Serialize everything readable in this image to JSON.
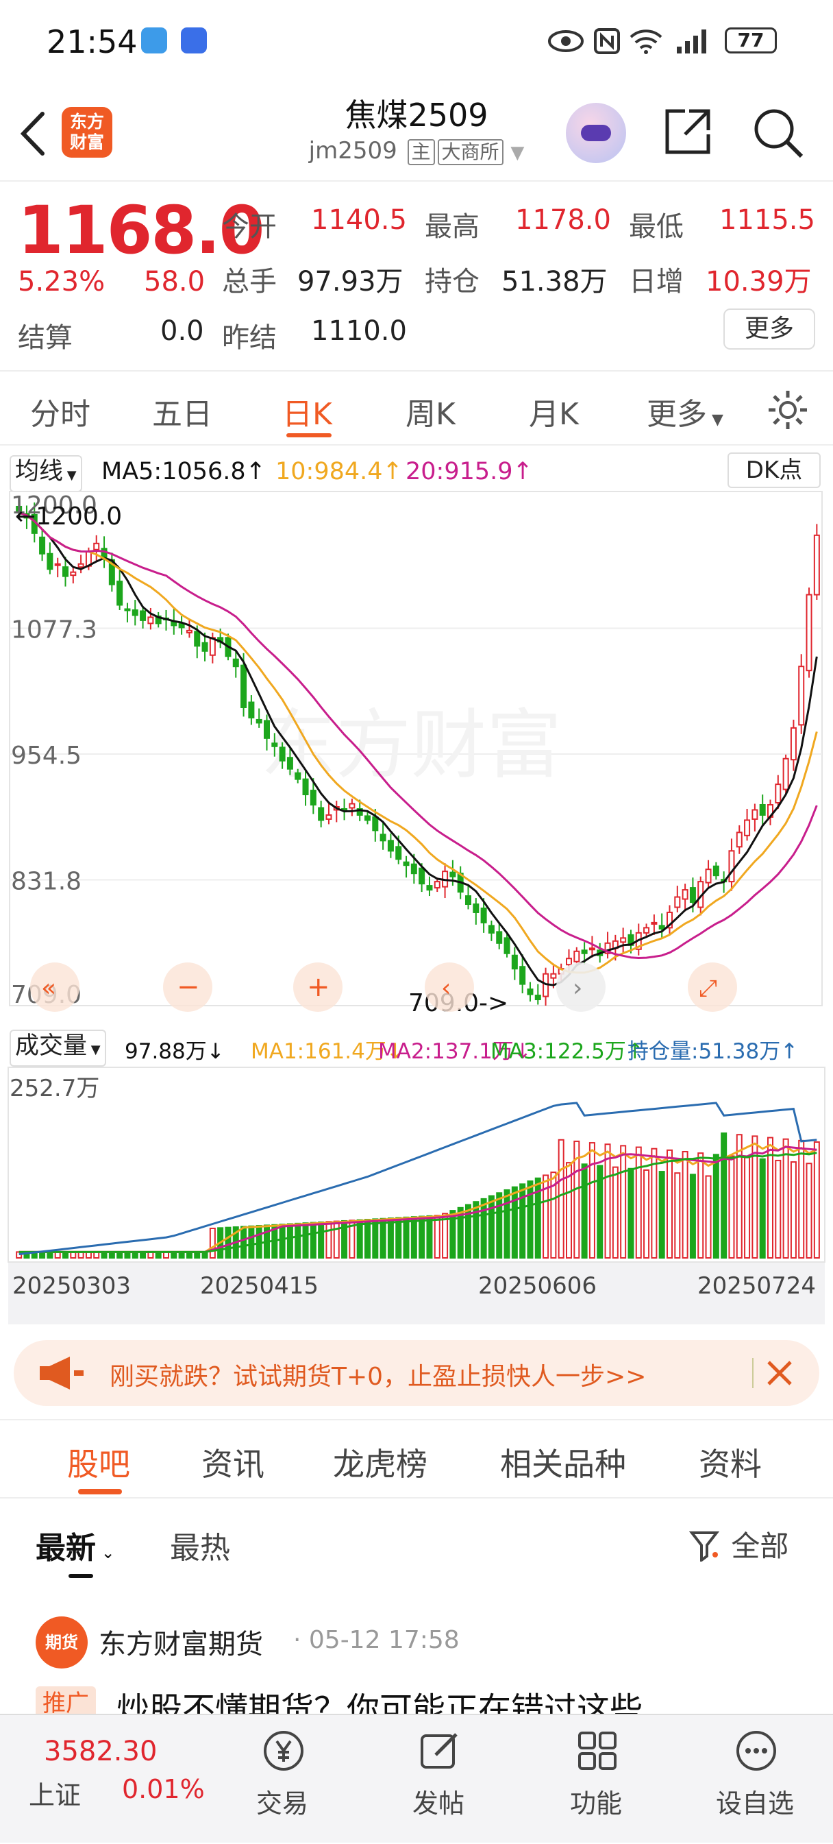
{
  "status_bar": {
    "time": "21:54",
    "battery": "77"
  },
  "header": {
    "back": "back",
    "logo_text": "东方\n财富",
    "title": "焦煤2509",
    "code": "jm2509",
    "tag_main": "主",
    "exchange": "大商所"
  },
  "quote": {
    "price": "1168.0",
    "change_pct": "5.23%",
    "change": "58.0",
    "settle_label": "结算",
    "settle": "0.0",
    "open_label": "今开",
    "open": "1140.5",
    "high_label": "最高",
    "high": "1178.0",
    "low_label": "最低",
    "low": "1115.5",
    "vol_label": "总手",
    "vol": "97.93万",
    "oi_label": "持仓",
    "oi": "51.38万",
    "daily_inc_label": "日增",
    "daily_inc": "10.39万",
    "prev_settle_label": "昨结",
    "prev_settle": "1110.0",
    "more": "更多"
  },
  "period_tabs": [
    "分时",
    "五日",
    "日K",
    "周K",
    "月K",
    "更多"
  ],
  "ma_bar": {
    "selector": "均线",
    "ma5": "MA5:1056.8↑",
    "ma10": "10:984.4↑",
    "ma20": "20:915.9↑",
    "dk": "DK点"
  },
  "colors": {
    "up": "#e0262e",
    "down": "#1ca61c",
    "ma5": "#111111",
    "ma10": "#f0a820",
    "ma20": "#c81e8c",
    "oi_line": "#2a6cb0",
    "accent": "#f05a24"
  },
  "chart_data": {
    "type": "candlestick",
    "y_ticks": [
      "1200.0",
      "1077.3",
      "954.5",
      "831.8",
      "709.0"
    ],
    "ylim": [
      709.0,
      1200.0
    ],
    "max_label": "←1200.0",
    "min_label": "709.0->",
    "watermark": "东方财富",
    "x_ticks": [
      "20250303",
      "20250415",
      "20250606",
      "20250724"
    ],
    "close": [
      1190,
      1185,
      1170,
      1150,
      1135,
      1140,
      1128,
      1132,
      1140,
      1152,
      1160,
      1145,
      1120,
      1100,
      1095,
      1090,
      1085,
      1088,
      1082,
      1086,
      1080,
      1078,
      1075,
      1060,
      1055,
      1068,
      1064,
      1050,
      1040,
      1000,
      990,
      985,
      970,
      962,
      948,
      940,
      930,
      915,
      905,
      890,
      895,
      903,
      900,
      906,
      895,
      890,
      880,
      870,
      860,
      852,
      846,
      838,
      828,
      822,
      830,
      840,
      835,
      820,
      808,
      800,
      790,
      780,
      770,
      760,
      745,
      730,
      720,
      715,
      740,
      740,
      745,
      755,
      762,
      760,
      765,
      758,
      770,
      772,
      775,
      768,
      780,
      785,
      790,
      784,
      800,
      815,
      822,
      810,
      830,
      842,
      836,
      830,
      860,
      878,
      890,
      900,
      895,
      905,
      925,
      950,
      980,
      1040,
      1110,
      1168
    ],
    "ma5_last": 1056.8,
    "ma10_last": 984.4,
    "ma20_last": 915.9
  },
  "volume_bar": {
    "selector": "成交量",
    "vol": "97.88万↓",
    "ma1": "MA1:161.4万↓",
    "ma2": "MA2:137.1万↓",
    "ma3": "MA3:122.5万↑",
    "oi": "持仓量:51.38万↑",
    "y_top": "252.7万"
  },
  "banner": {
    "text": "刚买就跌？试试期货T+0，止盈止损快人一步>>"
  },
  "bottom_tabs": [
    "股吧",
    "资讯",
    "龙虎榜",
    "相关品种",
    "资料"
  ],
  "filter": {
    "latest": "最新",
    "hot": "最热",
    "all": "全部"
  },
  "post": {
    "avatar": "期货",
    "author": "东方财富期货",
    "time": "· 05-12 17:58",
    "tag": "推广",
    "title": "炒股不懂期货？你可能正在错过这些"
  },
  "bottom_nav": {
    "index_value": "3582.30",
    "index_name": "上证",
    "index_change": "0.01%",
    "trade": "交易",
    "post": "发帖",
    "func": "功能",
    "watch": "设自选"
  }
}
